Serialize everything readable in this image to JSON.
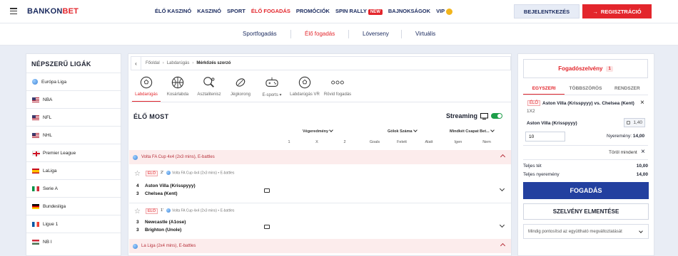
{
  "header": {
    "logo_left": "BANKON",
    "logo_right": "BET",
    "nav": [
      {
        "label": "ÉLŐ KASZINÓ"
      },
      {
        "label": "KASZINÓ"
      },
      {
        "label": "SPORT"
      },
      {
        "label": "ÉLŐ FOGADÁS",
        "active": true
      },
      {
        "label": "PROMÓCIÓK"
      },
      {
        "label": "SPIN RALLY",
        "badge": "NEW"
      },
      {
        "label": "BAJNOKSÁGOK"
      },
      {
        "label": "VIP"
      }
    ],
    "login_label": "BEJELENTKEZÉS",
    "register_label": "REGISZTRÁCIÓ"
  },
  "subnav": {
    "items": [
      "Sportfogadás",
      "Élő fogadás",
      "Lóverseny",
      "Virtuális"
    ],
    "active_index": 1
  },
  "sidebar": {
    "title": "NÉPSZERŰ LIGÁK",
    "leagues": [
      {
        "label": "Európa Liga",
        "flag": "globe"
      },
      {
        "label": "NBA",
        "flag": "us"
      },
      {
        "label": "NFL",
        "flag": "us"
      },
      {
        "label": "NHL",
        "flag": "us"
      },
      {
        "label": "Premier League",
        "flag": "en"
      },
      {
        "label": "LaLiga",
        "flag": "es"
      },
      {
        "label": "Serie A",
        "flag": "it"
      },
      {
        "label": "Bundesliga",
        "flag": "de"
      },
      {
        "label": "Ligue 1",
        "flag": "fr"
      },
      {
        "label": "NB I",
        "flag": "hu"
      }
    ]
  },
  "main": {
    "breadcrumb": [
      "Főoldal",
      "Labdarúgás",
      "Mérkőzés szorzó"
    ],
    "sports": [
      {
        "label": "Labdarúgás",
        "icon": "soccer-ball-icon",
        "active": true
      },
      {
        "label": "Kosárlabda",
        "icon": "basketball-icon"
      },
      {
        "label": "Asztalitenisz",
        "icon": "table-tennis-icon"
      },
      {
        "label": "Jégkorong",
        "icon": "ice-hockey-icon"
      },
      {
        "label": "E-sports",
        "icon": "gamepad-icon"
      },
      {
        "label": "Labdarúgás VR",
        "icon": "soccer-ball-icon"
      },
      {
        "label": "Rövid fogadás",
        "icon": "more-icon"
      }
    ],
    "section_title": "ÉLŐ MOST",
    "streaming_label": "Streaming",
    "markets": [
      {
        "label": "Végeredmény"
      },
      {
        "label": "Gólok Száma"
      },
      {
        "label": "Mindkét Csapat Bet..."
      }
    ],
    "columns": [
      "1",
      "X",
      "2",
      "Goals",
      "Felett",
      "Alatt",
      "Igen",
      "Nem"
    ],
    "competitions": [
      {
        "name": "Volta FA Cup 4x4 (2x3 mins), E-battles",
        "matches": [
          {
            "live": "ÉLŐ",
            "minute": "2'",
            "comp": "Volta FA Cup 4x4 (2x3 mins) • E-battles",
            "home_score": "4",
            "home": "Aston Villa (Krisspyyy)",
            "away_score": "3",
            "away": "Chelsea (Kent)"
          },
          {
            "live": "ÉLŐ",
            "minute": "1'",
            "comp": "Volta FA Cup 4x4 (2x3 mins) • E-battles",
            "home_score": "3",
            "home": "Newcastle (A1ose)",
            "away_score": "3",
            "away": "Brighton (Unole)"
          }
        ]
      },
      {
        "name": "La Liga (2x4 mins), E-battles",
        "matches": []
      }
    ]
  },
  "betslip": {
    "title": "Fogadószelvény",
    "count": "1",
    "tabs": [
      "EGYSZERI",
      "TÖBBSZÖRÖS",
      "RENDSZER"
    ],
    "active_tab": 0,
    "bet": {
      "live": "ÉLŐ",
      "match": "Aston Villa (Krisspyyy) vs. Chelsea (Kent)",
      "market": "1X2",
      "selection": "Aston Villa (Krisspyyy)",
      "odds": "1,40",
      "stake": "10",
      "winnings_label": "Nyeremény:",
      "winnings_value": "14,00"
    },
    "clear_all": "Töröl mindent",
    "total_stake_label": "Teljes tét",
    "total_stake_value": "10,00",
    "total_win_label": "Teljes nyeremény",
    "total_win_value": "14,00",
    "place_bet_label": "FOGADÁS",
    "save_label": "SZELVÉNY ELMENTÉSE",
    "accept_option": "Mindig pontosítsd az együttható megváltoztatását"
  },
  "colors": {
    "accent": "#e3262c",
    "primary": "#23409f",
    "brand_dark": "#1a2a5e"
  }
}
